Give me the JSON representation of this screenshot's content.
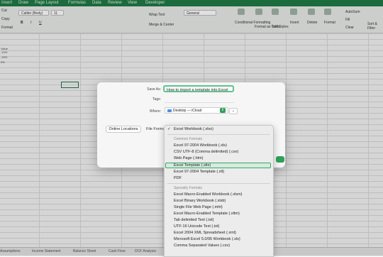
{
  "menu_tabs": [
    "Insert",
    "Draw",
    "Page Layout",
    "Formulas",
    "Data",
    "Review",
    "View",
    "Developer"
  ],
  "ribbon": {
    "font_name": "Calibri (Body)",
    "font_size": "11",
    "wrap_text": "Wrap Text",
    "number_format": "General",
    "merge_center": "Merge & Center",
    "left_labels": [
      "Cut",
      "Copy",
      "Format"
    ],
    "groups": [
      "Conditional Formatting",
      "Format as Table",
      "Cell Styles",
      "Insert",
      "Delete",
      "Format"
    ],
    "autosum": "AutoSum",
    "fill": "Fill",
    "clear": "Clear",
    "sort_filter": "Sort & Filter"
  },
  "grid_texts": [
    "Value",
    "-10%",
    "-15%",
    "5%"
  ],
  "sheet_tabs": [
    "Assumptions",
    "Income Statement",
    "Balance Sheet",
    "Cash Flow",
    "DCF Analysis"
  ],
  "dialog": {
    "save_as_label": "Save As:",
    "save_as_value": "How to import a template into Excel",
    "tags_label": "Tags:",
    "where_label": "Where:",
    "where_value": "Desktop — iCloud",
    "online_locations": "Online Locations",
    "file_format_label": "File Format"
  },
  "format_menu": {
    "selected": "Excel Workbook (.xlsx)",
    "common_header": "Common Formats",
    "common": [
      "Excel 97-2004 Workbook (.xls)",
      "CSV UTF-8 (Comma delimited) (.csv)",
      "Web Page (.htm)",
      "Excel Template (.xltx)",
      "Excel 97-2004 Template (.xlt)",
      "PDF"
    ],
    "highlighted": "Excel Template (.xltx)",
    "specialty_header": "Specialty Formats",
    "specialty": [
      "Excel Macro-Enabled Workbook (.xlsm)",
      "Excel Binary Workbook (.xlsb)",
      "Single File Web Page (.mht)",
      "Excel Macro-Enabled Template (.xltm)",
      "Tab delimited Text (.txt)",
      "UTF-16 Unicode Text (.txt)",
      "Excel 2004 XML Spreadsheet (.xml)",
      "Microsoft Excel 5.0/95 Workbook (.xls)",
      "Comma Separated Values (.csv)"
    ]
  }
}
